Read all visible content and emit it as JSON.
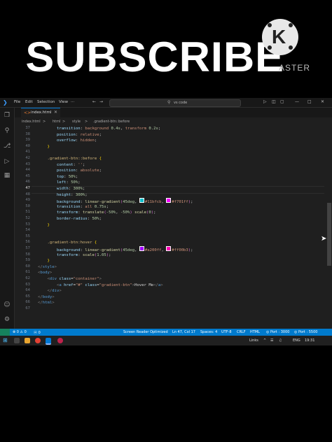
{
  "overlay": {
    "headline": "SUBSCRIBE",
    "logo_letter": "K",
    "logo_text": "ASTER"
  },
  "titlebar": {
    "menus": [
      "File",
      "Edit",
      "Selection",
      "View",
      "···"
    ],
    "command_center": "vs code"
  },
  "tab": {
    "label": "index.html",
    "icon": "html-file-icon"
  },
  "breadcrumb": [
    "index.html",
    ">",
    "html",
    ">",
    "style",
    ">",
    ".gradient-btn::before"
  ],
  "editor": {
    "current_line": 47,
    "lines": [
      {
        "n": 37,
        "html": "        <span class='p'>transition</span>: <span class='v'>background</span> <span class='n'>0.4s</span>, <span class='v'>transform</span> <span class='n'>0.2s</span>;"
      },
      {
        "n": 38,
        "html": "        <span class='p'>position</span>: <span class='v'>relative</span>;"
      },
      {
        "n": 39,
        "html": "        <span class='p'>overflow</span>: <span class='v'>hidden</span>;"
      },
      {
        "n": 40,
        "html": "    <span class='y'>}</span>"
      },
      {
        "n": 41,
        "html": ""
      },
      {
        "n": 42,
        "html": "    <span class='s'>.gradient-btn::before</span> <span class='y'>{</span>"
      },
      {
        "n": 43,
        "html": "        <span class='p'>content</span>: <span class='v'>''</span>;"
      },
      {
        "n": 44,
        "html": "        <span class='p'>position</span>: <span class='v'>absolute</span>;"
      },
      {
        "n": 45,
        "html": "        <span class='p'>top</span>: <span class='n'>50%</span>;"
      },
      {
        "n": 46,
        "html": "        <span class='p'>left</span>: <span class='n'>50%</span>;"
      },
      {
        "n": 47,
        "html": "        <span class='p'>width</span>: <span class='n'>300%</span>;"
      },
      {
        "n": 48,
        "html": "        <span class='p'>height</span>: <span class='n'>300%</span>;"
      },
      {
        "n": 49,
        "html": "        <span class='p'>background</span>: <span class='f'>linear-gradient</span><span class='pu'>(</span><span class='n'>45deg</span>, <span class='sw' style='background:#11bfcb'></span><span class='v'>#11bfcb</span>, <span class='sw' style='background:#f701ff'></span><span class='v'>#f701ff</span><span class='pu'>)</span>;"
      },
      {
        "n": 50,
        "html": "        <span class='p'>transition</span>: <span class='v'>all</span> <span class='n'>0.75s</span>;"
      },
      {
        "n": 51,
        "html": "        <span class='p'>transform</span>: <span class='f'>translate</span><span class='pu'>(</span><span class='n'>-50%</span>, <span class='n'>-50%</span><span class='pu'>)</span> <span class='f'>scale</span><span class='pu'>(</span><span class='n'>0</span><span class='pu'>)</span>;"
      },
      {
        "n": 52,
        "html": "        <span class='p'>border-radius</span>: <span class='n'>50%</span>;"
      },
      {
        "n": 53,
        "html": "    <span class='y'>}</span>"
      },
      {
        "n": 54,
        "html": ""
      },
      {
        "n": 55,
        "html": ""
      },
      {
        "n": 56,
        "html": "    <span class='s'>.gradient-btn:hover</span> <span class='y'>{</span>"
      },
      {
        "n": 57,
        "html": "        <span class='p'>background</span>: <span class='f'>linear-gradient</span><span class='pu'>(</span><span class='n'>45deg</span>, <span class='sw' style='background:#a200ff'></span><span class='v'>#a200ff</span>, <span class='sw' style='background:#ff00b3'></span><span class='v'>#ff00b3</span><span class='pu'>)</span>;"
      },
      {
        "n": 58,
        "html": "        <span class='p'>transform</span>: <span class='f'>scale</span><span class='pu'>(</span><span class='n'>1.05</span><span class='pu'>)</span>;"
      },
      {
        "n": 59,
        "html": "    <span class='y'>}</span>"
      },
      {
        "n": 60,
        "html": "<span class='br'>&lt;/</span><span class='tag'>style</span><span class='br'>&gt;</span>"
      },
      {
        "n": 61,
        "html": "<span class='br'>&lt;</span><span class='tag'>body</span><span class='br'>&gt;</span>"
      },
      {
        "n": 62,
        "html": "    <span class='br'>&lt;</span><span class='tag'>div</span> <span class='at'>class</span>=<span class='str'>\"container\"</span><span class='br'>&gt;</span>"
      },
      {
        "n": 63,
        "html": "        <span class='br'>&lt;</span><span class='tag'>a</span> <span class='at'>href</span>=<span class='str'>\"#\"</span> <span class='at'>class</span>=<span class='str'>\"gradient-btn\"</span><span class='br'>&gt;</span>Hover Me<span class='br'>&lt;/</span><span class='tag'>a</span><span class='br'>&gt;</span>"
      },
      {
        "n": 64,
        "html": "    <span class='br'>&lt;/</span><span class='tag'>div</span><span class='br'>&gt;</span>"
      },
      {
        "n": 65,
        "html": "<span class='br'>&lt;/</span><span class='tag'>body</span><span class='br'>&gt;</span>"
      },
      {
        "n": 66,
        "html": "<span class='br'>&lt;/</span><span class='tag'>html</span><span class='br'>&gt;</span>"
      },
      {
        "n": 67,
        "html": ""
      }
    ]
  },
  "statusbar": {
    "errors": "⊗ 0 ⚠ 0",
    "ports": "ⓦ 0",
    "screen_reader": "Screen Reader Optimized",
    "position": "Ln 47, Col 17",
    "spaces": "Spaces: 4",
    "encoding": "UTF-8",
    "eol": "CRLF",
    "language": "HTML",
    "port1": "◎ Port : 3000",
    "port2": "◎ Port : 5500"
  },
  "taskbar": {
    "links": "Links",
    "lang": "ENG",
    "time": "19:31"
  }
}
